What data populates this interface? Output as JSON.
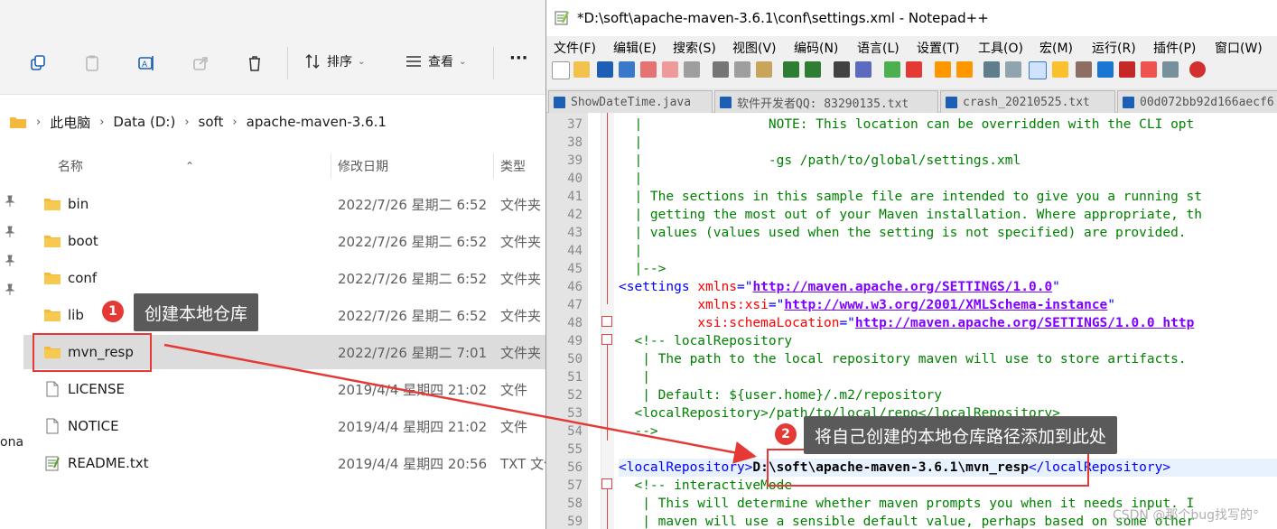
{
  "explorer": {
    "toolbar": {
      "sort_label": "排序",
      "view_label": "查看",
      "more_label": "···"
    },
    "breadcrumb": [
      "此电脑",
      "Data (D:)",
      "soft",
      "apache-maven-3.6.1"
    ],
    "columns": {
      "name": "名称",
      "modified": "修改日期",
      "type": "类型"
    },
    "files": [
      {
        "name": "bin",
        "date": "2022/7/26 星期二 6:52",
        "type": "文件夹",
        "kind": "folder"
      },
      {
        "name": "boot",
        "date": "2022/7/26 星期二 6:52",
        "type": "文件夹",
        "kind": "folder"
      },
      {
        "name": "conf",
        "date": "2022/7/26 星期二 6:52",
        "type": "文件夹",
        "kind": "folder"
      },
      {
        "name": "lib",
        "date": "2022/7/26 星期二 6:52",
        "type": "文件夹",
        "kind": "folder"
      },
      {
        "name": "mvn_resp",
        "date": "2022/7/26 星期二 7:01",
        "type": "文件夹",
        "kind": "folder"
      },
      {
        "name": "LICENSE",
        "date": "2019/4/4 星期四 21:02",
        "type": "文件",
        "kind": "file"
      },
      {
        "name": "NOTICE",
        "date": "2019/4/4 星期四 21:02",
        "type": "文件",
        "kind": "file"
      },
      {
        "name": "README.txt",
        "date": "2019/4/4 星期四 20:56",
        "type": "TXT 文件",
        "kind": "txt"
      }
    ],
    "cut_off_text": "ona"
  },
  "notepad": {
    "title": "*D:\\soft\\apache-maven-3.6.1\\conf\\settings.xml - Notepad++",
    "menu": [
      "文件(F)",
      "编辑(E)",
      "搜索(S)",
      "视图(V)",
      "编码(N)",
      "语言(L)",
      "设置(T)",
      "工具(O)",
      "宏(M)",
      "运行(R)",
      "插件(P)",
      "窗口(W)"
    ],
    "tabs": [
      "ShowDateTime.java",
      "软件开发者QQ: 83290135.txt",
      "crash_20210525.txt",
      "00d072bb92d166aecf6"
    ],
    "lines": [
      {
        "n": "37",
        "parts": [
          [
            "cm",
            "  |                NOTE: This location can be overridden with the CLI opt"
          ]
        ]
      },
      {
        "n": "38",
        "parts": [
          [
            "cm",
            "  |"
          ]
        ]
      },
      {
        "n": "39",
        "parts": [
          [
            "cm",
            "  |                -gs /path/to/global/settings.xml"
          ]
        ]
      },
      {
        "n": "40",
        "parts": [
          [
            "cm",
            "  |"
          ]
        ]
      },
      {
        "n": "41",
        "parts": [
          [
            "cm",
            "  | The sections in this sample file are intended to give you a running st"
          ]
        ]
      },
      {
        "n": "42",
        "parts": [
          [
            "cm",
            "  | getting the most out of your Maven installation. Where appropriate, th"
          ]
        ]
      },
      {
        "n": "43",
        "parts": [
          [
            "cm",
            "  | values (values used when the setting is not specified) are provided."
          ]
        ]
      },
      {
        "n": "44",
        "parts": [
          [
            "cm",
            "  |"
          ]
        ]
      },
      {
        "n": "45",
        "parts": [
          [
            "cm",
            "  |-->"
          ]
        ]
      },
      {
        "n": "46",
        "parts": [
          [
            "tg",
            "<settings "
          ],
          [
            "at",
            "xmlns"
          ],
          [
            "tg",
            "=\""
          ],
          [
            "vl",
            "http://maven.apache.org/SETTINGS/1.0.0"
          ],
          [
            "tg",
            "\""
          ]
        ]
      },
      {
        "n": "47",
        "parts": [
          [
            "tg",
            "          "
          ],
          [
            "at",
            "xmlns:xsi"
          ],
          [
            "tg",
            "=\""
          ],
          [
            "vl",
            "http://www.w3.org/2001/XMLSchema-instance"
          ],
          [
            "tg",
            "\""
          ]
        ]
      },
      {
        "n": "48",
        "parts": [
          [
            "tg",
            "          "
          ],
          [
            "at",
            "xsi:schemaLocation"
          ],
          [
            "tg",
            "=\""
          ],
          [
            "vl",
            "http://maven.apache.org/SETTINGS/1.0.0 http"
          ]
        ]
      },
      {
        "n": "49",
        "parts": [
          [
            "cm",
            "  <!-- localRepository"
          ]
        ]
      },
      {
        "n": "50",
        "parts": [
          [
            "cm",
            "   | The path to the local repository maven will use to store artifacts."
          ]
        ]
      },
      {
        "n": "51",
        "parts": [
          [
            "cm",
            "   |"
          ]
        ]
      },
      {
        "n": "52",
        "parts": [
          [
            "cm",
            "   | Default: ${user.home}/.m2/repository"
          ]
        ]
      },
      {
        "n": "53",
        "parts": [
          [
            "cm",
            "  <localRepository>/path/to/local/repo</localRepository>"
          ]
        ]
      },
      {
        "n": "54",
        "parts": [
          [
            "cm",
            "  -->"
          ]
        ]
      },
      {
        "n": "55",
        "parts": [
          [
            "tg",
            ""
          ]
        ]
      },
      {
        "n": "56",
        "parts": [
          [
            "tg",
            "<localRepository>"
          ],
          [
            "txt",
            "D:\\soft\\apache-maven-3.6.1\\mvn_resp"
          ],
          [
            "tg",
            "</localRepository>"
          ]
        ]
      },
      {
        "n": "57",
        "parts": [
          [
            "cm",
            "  <!-- interactiveMode"
          ]
        ]
      },
      {
        "n": "58",
        "parts": [
          [
            "cm",
            "   | This will determine whether maven prompts you when it needs input. I"
          ]
        ]
      },
      {
        "n": "59",
        "parts": [
          [
            "cm",
            "   | maven will use a sensible default value, perhaps based on some other"
          ]
        ]
      }
    ]
  },
  "annotations": {
    "step1_number": "1",
    "step1_text": "创建本地仓库",
    "step2_number": "2",
    "step2_text": "将自己创建的本地仓库路径添加到此处",
    "accent": "#e53935"
  },
  "watermark": "CSDN @那个bug找写的°"
}
